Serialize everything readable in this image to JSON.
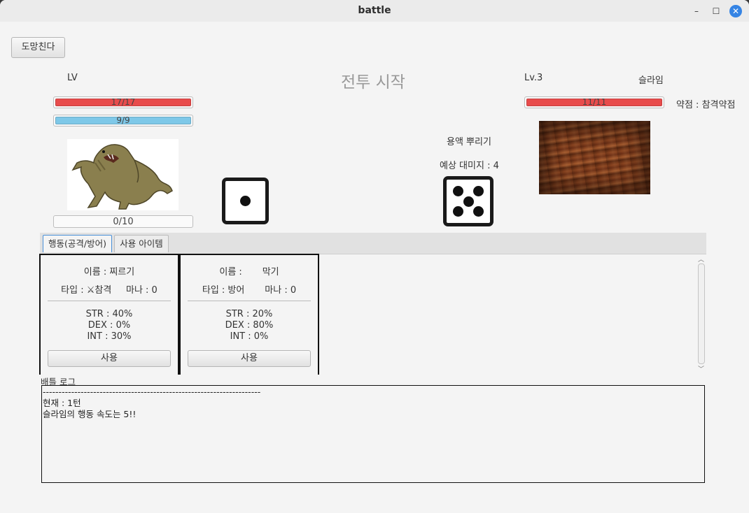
{
  "window": {
    "title": "battle"
  },
  "controls": {
    "flee_label": "도망친다"
  },
  "header": {
    "title": "전투 시작"
  },
  "player": {
    "level_label": "LV",
    "hp": {
      "text": "17/17",
      "fraction": 1.0,
      "color": "#e84c4c"
    },
    "mp": {
      "text": "9/9",
      "fraction": 1.0,
      "color": "#7ec8e8"
    },
    "exp": {
      "text": "0/10",
      "fraction": 0.0
    }
  },
  "enemy": {
    "level_label": "Lv.3",
    "name": "슬라임",
    "hp": {
      "text": "11/11",
      "fraction": 1.0,
      "color": "#e84c4c"
    },
    "weakness": "약점 : 참격약점",
    "action": "용액 뿌리기",
    "expected_damage": "예상 대미지 : 4"
  },
  "dice": {
    "player_value": 1,
    "enemy_value": 5
  },
  "tabs": [
    {
      "label": "행동(공격/방어)",
      "active": true
    },
    {
      "label": "사용 아이템",
      "active": false
    }
  ],
  "skills": [
    {
      "name_line": "이름 : 찌르기",
      "type_line": "타입 : ⚔참격",
      "mana_line": "마나 : 0",
      "str": "STR : 40%",
      "dex": "DEX : 0%",
      "int": "INT : 30%",
      "use_label": "사용"
    },
    {
      "name_line": "이름 :       막기",
      "type_line": "타입 : 방어",
      "mana_line": "마나 : 0",
      "str": "STR : 20%",
      "dex": "DEX : 80%",
      "int": "INT : 0%",
      "use_label": "사용"
    }
  ],
  "log": {
    "label": "배틀 로그",
    "lines": [
      "---------------------------------------------------------------------",
      "현재 : 1턴",
      "슬라임의 행동 속도는 5!!"
    ]
  }
}
